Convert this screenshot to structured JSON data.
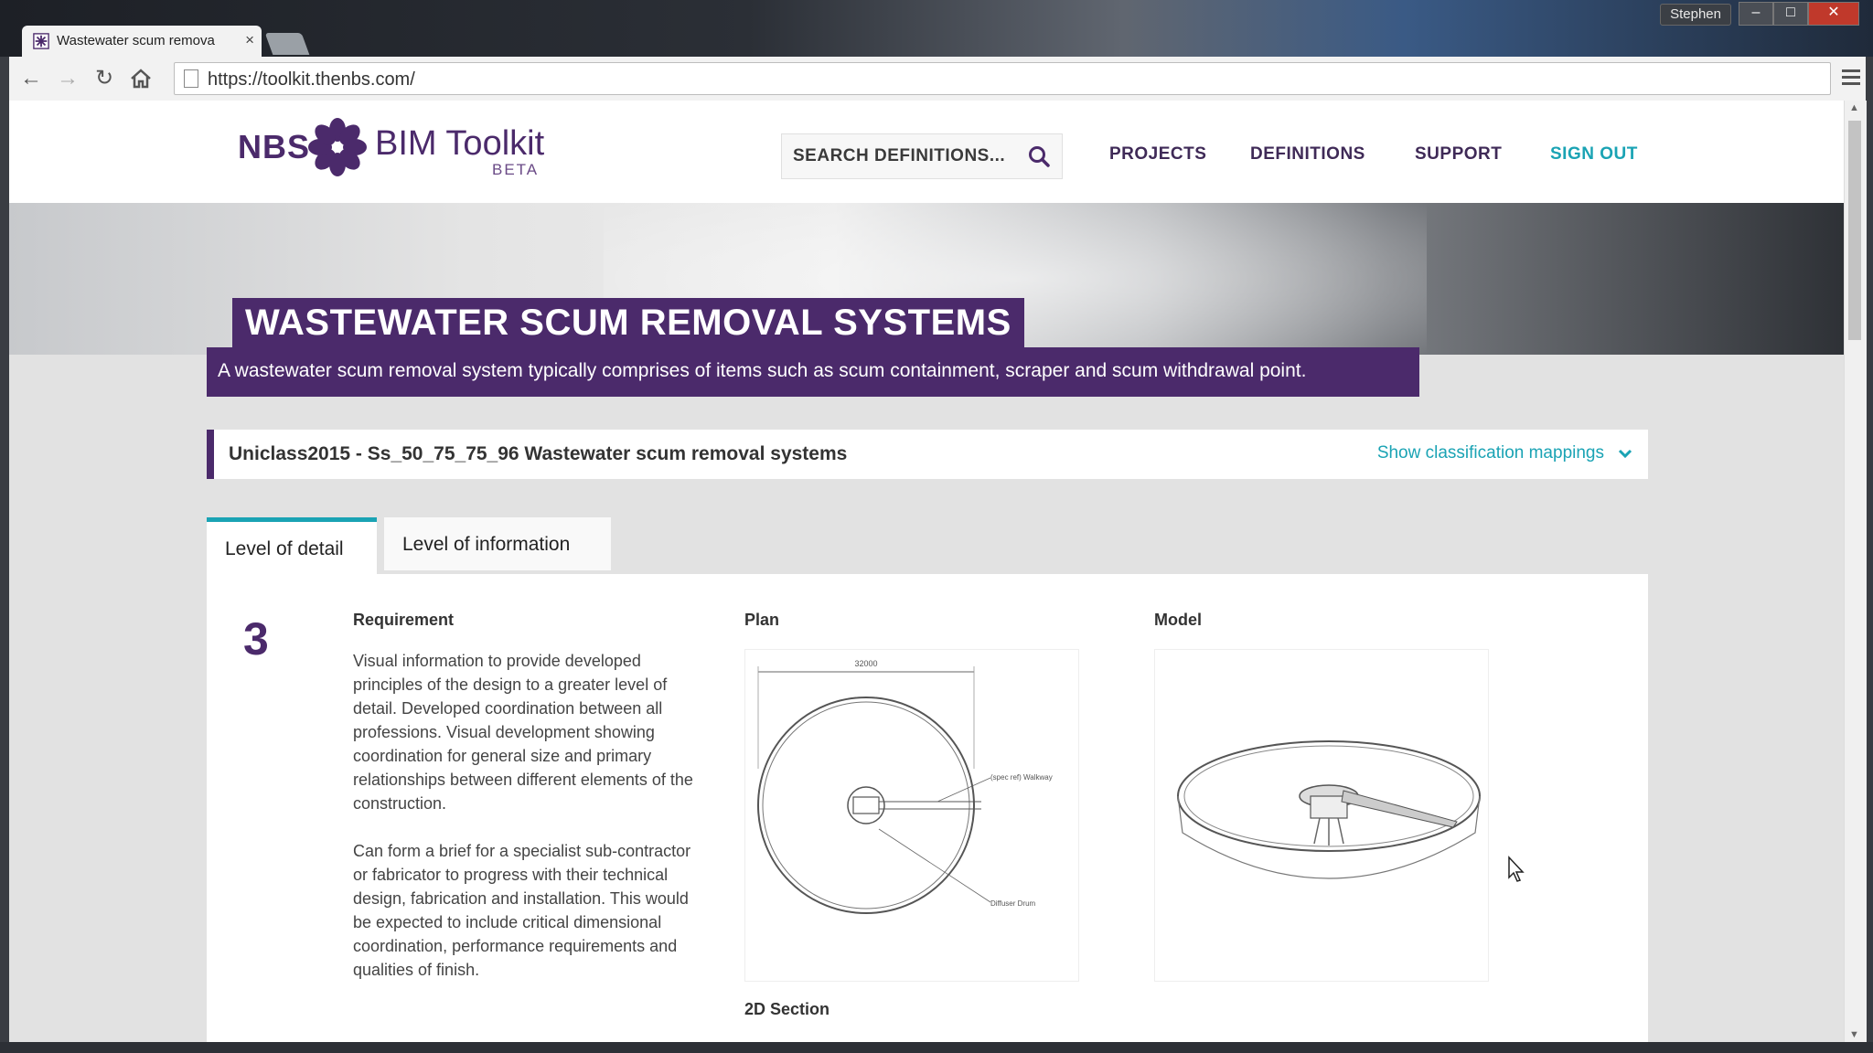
{
  "browser": {
    "tab_title": "Wastewater scum remova",
    "tab_close": "×",
    "url": "https://toolkit.thenbs.com/",
    "window_user": "Stephen"
  },
  "header": {
    "logo_nbs": "NBS",
    "logo_product": "BIM Toolkit",
    "logo_beta": "BETA",
    "search_placeholder": "SEARCH DEFINITIONS...",
    "nav": [
      "PROJECTS",
      "DEFINITIONS",
      "SUPPORT",
      "SIGN OUT"
    ]
  },
  "hero": {
    "title": "WASTEWATER SCUM REMOVAL SYSTEMS",
    "description": "A wastewater scum removal system typically comprises of items such as scum containment, scraper and scum withdrawal point."
  },
  "classification": {
    "text": "Uniclass2015 - Ss_50_75_75_96 Wastewater scum removal systems",
    "toggle": "Show classification mappings"
  },
  "tabs": [
    "Level of detail",
    "Level of information"
  ],
  "detail": {
    "level": "3",
    "requirement_heading": "Requirement",
    "paragraph1": "Visual information to provide developed principles of the design to a greater level of detail. Developed coordination between all professions. Visual development showing coordination for general size and primary relationships between different elements of the construction.",
    "paragraph2": "Can form a brief for a specialist sub-contractor or fabricator to progress with their technical design, fabrication and installation. This would be expected to include critical dimensional coordination, performance requirements and qualities of finish.",
    "plan_heading": "Plan",
    "model_heading": "Model",
    "section_heading": "2D Section",
    "plan_labels": {
      "dimension": "32000",
      "walkway": "(spec ref) Walkway",
      "diffuser": "Diffuser Drum"
    }
  },
  "colors": {
    "brand_purple": "#4b2a6b",
    "accent_teal": "#1aa3b4"
  }
}
